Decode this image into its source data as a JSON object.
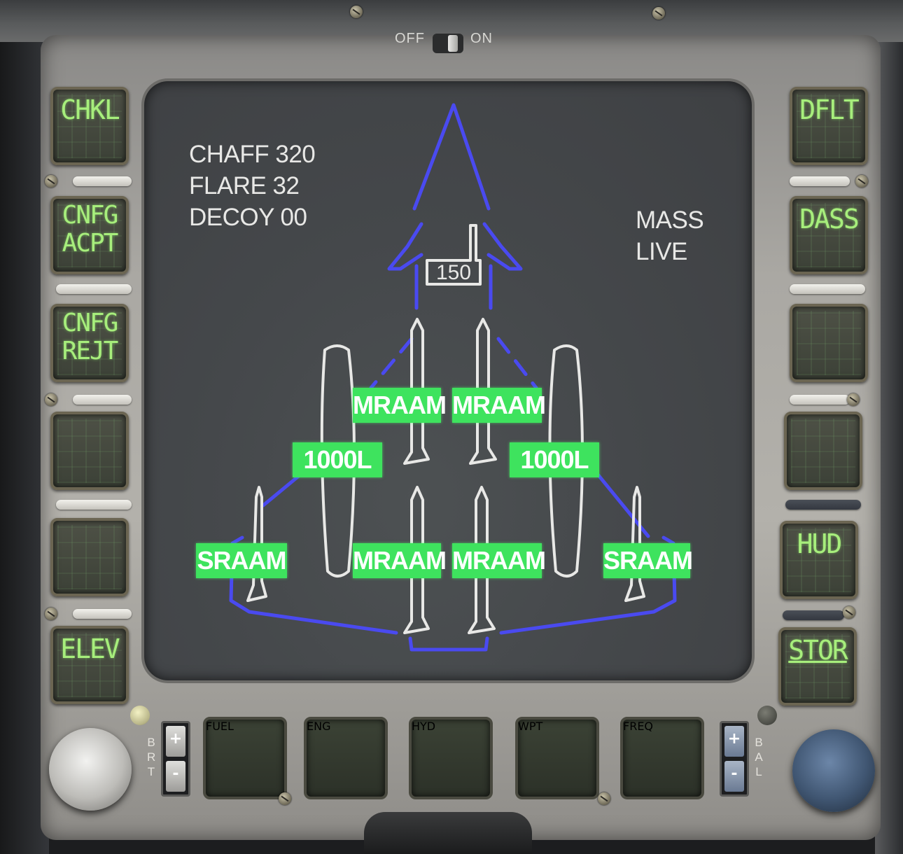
{
  "top_switch": {
    "off_label": "OFF",
    "on_label": "ON"
  },
  "display": {
    "countermeasures": [
      "CHAFF 320",
      "FLARE 32",
      "DECOY 00"
    ],
    "mode": [
      "MASS",
      "LIVE"
    ],
    "centerline_value": "150",
    "stations": {
      "mraam_upper_left": "MRAAM",
      "mraam_upper_right": "MRAAM",
      "tank_left": "1000L",
      "tank_right": "1000L",
      "sraam_left": "SRAAM",
      "mraam_lower_left": "MRAAM",
      "mraam_lower_right": "MRAAM",
      "sraam_right": "SRAAM"
    }
  },
  "left_keys": [
    "CHKL",
    "CNFG\nACPT",
    "CNFG\nREJT",
    "",
    "",
    "ELEV"
  ],
  "right_keys": [
    "DFLT",
    "DASS",
    "",
    "",
    "HUD",
    "STOR"
  ],
  "bottom_keys": [
    "FUEL",
    "ENG",
    "HYD",
    "WPT",
    "FREQ"
  ],
  "brightness": {
    "label": "BRT",
    "plus": "+",
    "minus": "-"
  },
  "balance": {
    "label": "BAL",
    "plus": "+",
    "minus": "-"
  },
  "colors": {
    "symbology_blue": "#4a4af0",
    "station_green": "#3ee35e",
    "key_legend_green": "#a7ee7c"
  }
}
